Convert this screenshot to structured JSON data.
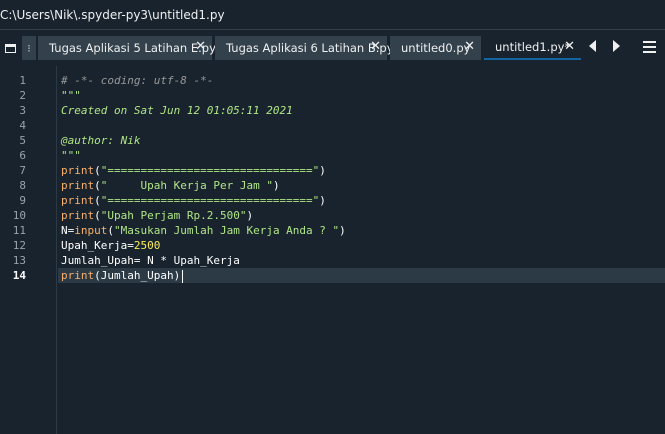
{
  "window": {
    "title": "C:\\Users\\Nik\\.spyder-py3\\untitled1.py"
  },
  "tabs": [
    {
      "label": "Tugas Aplikasi 5 Latihan E.py",
      "close": "✕",
      "active": false
    },
    {
      "label": "Tugas Aplikasi 6 Latihan B.py",
      "close": "✕",
      "active": false
    },
    {
      "label": "untitled0.py",
      "close": "✕",
      "active": false
    },
    {
      "label": "untitled1.py*",
      "close": "✕",
      "active": true
    }
  ],
  "icons": {
    "browse_tabs": "browse-tabs-icon",
    "scroll_left": "triangle-left-icon",
    "scroll_right": "triangle-right-icon",
    "options": "hamburger-menu-icon"
  },
  "editor": {
    "current_line": 14,
    "line_numbers": [
      "1",
      "2",
      "3",
      "4",
      "5",
      "6",
      "7",
      "8",
      "9",
      "10",
      "11",
      "12",
      "13",
      "14"
    ],
    "lines": [
      [
        {
          "t": "comment",
          "v": "# -*- coding: utf-8 -*-"
        }
      ],
      [
        {
          "t": "docstring",
          "v": "\"\"\""
        }
      ],
      [
        {
          "t": "docstring",
          "v": "Created on Sat Jun 12 01:05:11 2021"
        }
      ],
      [],
      [
        {
          "t": "docstring",
          "v": "@author: Nik"
        }
      ],
      [
        {
          "t": "docstring",
          "v": "\"\"\""
        }
      ],
      [
        {
          "t": "builtin",
          "v": "print"
        },
        {
          "t": "op",
          "v": "("
        },
        {
          "t": "string",
          "v": "\"===============================\""
        },
        {
          "t": "op",
          "v": ")"
        }
      ],
      [
        {
          "t": "builtin",
          "v": "print"
        },
        {
          "t": "op",
          "v": "("
        },
        {
          "t": "string",
          "v": "\"     Upah Kerja Per Jam \""
        },
        {
          "t": "op",
          "v": ")"
        }
      ],
      [
        {
          "t": "builtin",
          "v": "print"
        },
        {
          "t": "op",
          "v": "("
        },
        {
          "t": "string",
          "v": "\"===============================\""
        },
        {
          "t": "op",
          "v": ")"
        }
      ],
      [
        {
          "t": "builtin",
          "v": "print"
        },
        {
          "t": "op",
          "v": "("
        },
        {
          "t": "string",
          "v": "\"Upah Perjam Rp.2.500\""
        },
        {
          "t": "op",
          "v": ")"
        }
      ],
      [
        {
          "t": "ident",
          "v": "N"
        },
        {
          "t": "op",
          "v": "="
        },
        {
          "t": "builtin",
          "v": "input"
        },
        {
          "t": "op",
          "v": "("
        },
        {
          "t": "string",
          "v": "\"Masukan Jumlah Jam Kerja Anda ? \""
        },
        {
          "t": "op",
          "v": ")"
        }
      ],
      [
        {
          "t": "ident",
          "v": "Upah_Kerja"
        },
        {
          "t": "op",
          "v": "="
        },
        {
          "t": "number",
          "v": "2500"
        }
      ],
      [
        {
          "t": "ident",
          "v": "Jumlah_Upah"
        },
        {
          "t": "op",
          "v": "= "
        },
        {
          "t": "ident",
          "v": "N"
        },
        {
          "t": "op",
          "v": " * "
        },
        {
          "t": "ident",
          "v": "Upah_Kerja"
        }
      ],
      [
        {
          "t": "builtin",
          "v": "print"
        },
        {
          "t": "op",
          "v": "("
        },
        {
          "t": "ident",
          "v": "Jumlah_Upah"
        },
        {
          "t": "op",
          "v": ")"
        }
      ]
    ]
  },
  "colors": {
    "background": "#19232d",
    "tab_background": "#32414b",
    "active_tab_underline": "#1464a0",
    "current_line": "#2b3a45",
    "string": "#b0e686",
    "builtin": "#fab16c",
    "number": "#faed5c",
    "comment": "#999999"
  }
}
